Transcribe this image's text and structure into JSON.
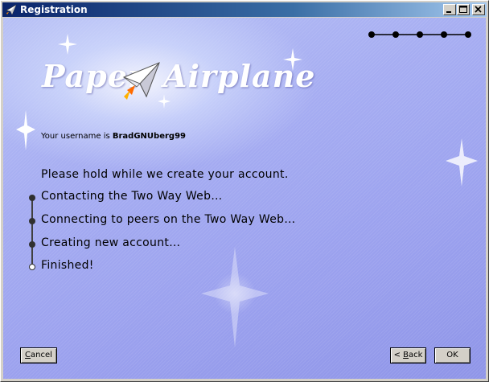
{
  "window": {
    "title": "Registration",
    "controls": {
      "minimize": "minimize-icon",
      "maximize": "maximize-icon",
      "close": "close-icon"
    }
  },
  "logo": {
    "left_text": "Paper",
    "right_text": "Airplane"
  },
  "progress": {
    "total_steps": 5,
    "current_step": 5
  },
  "account": {
    "username_prefix": "Your username is ",
    "username": "BradGNUberg99"
  },
  "status": {
    "message": "Please hold while we create your account."
  },
  "steps": [
    {
      "label": "Contacting the Two Way Web…",
      "state": "done"
    },
    {
      "label": "Connecting to peers on the Two Way Web…",
      "state": "done"
    },
    {
      "label": "Creating new account…",
      "state": "done"
    },
    {
      "label": "Finished!",
      "state": "current"
    }
  ],
  "buttons": {
    "cancel": {
      "label_accel": "C",
      "label_rest": "ancel"
    },
    "back": {
      "label_prefix": "< ",
      "label_accel": "B",
      "label_rest": "ack"
    },
    "ok": {
      "label": "OK"
    }
  },
  "colors": {
    "titlebar_start": "#0a246a",
    "titlebar_end": "#a6caf0",
    "background": "#a6adf2",
    "button_face": "#d4d0c8"
  }
}
